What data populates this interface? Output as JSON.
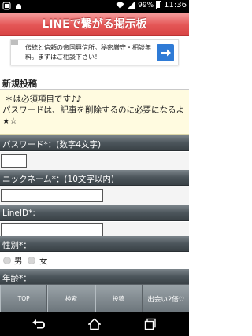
{
  "status_bar": {
    "battery": "99%",
    "time": "11:36"
  },
  "header": {
    "title": "LINEで繋がる掲示板"
  },
  "ad": {
    "text": "伝統と信頼の帝国興信所。秘密厳守・相談無料。まずはご相談下さい！",
    "icon": "arrow-right-icon"
  },
  "section": {
    "title": "新規投稿"
  },
  "notice": {
    "line1": "＊は必須項目です♪♪",
    "line2": "パスワードは、記事を削除するのに必要になるよ★☆"
  },
  "fields": {
    "password_label": "パスワード*：(数字4文字)",
    "nickname_label": "ニックネーム*：(10文字以内)",
    "lineid_label": "LineID*:",
    "gender_label": "性別*：",
    "gender_options": [
      "男",
      "女"
    ],
    "age_label": "年齢*："
  },
  "tabbar": {
    "items": [
      "TOP",
      "検索",
      "投稿",
      "出会い2倍♡"
    ]
  },
  "colors": {
    "header_red": "#e45656",
    "field_bar": "#4c555b",
    "notice_bg": "#fffbe0",
    "ad_button": "#2f7bd6"
  }
}
